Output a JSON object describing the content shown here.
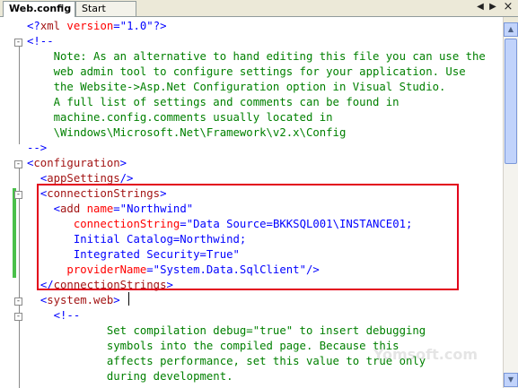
{
  "tabs": [
    {
      "label": "Web.config",
      "active": true
    },
    {
      "label": "Start Page",
      "active": false
    }
  ],
  "tab_controls": {
    "prev": "◀",
    "next": "▶",
    "close": "×"
  },
  "code_lines": [
    [
      {
        "c": "b",
        "t": "<?"
      },
      {
        "c": "m",
        "t": "xml"
      },
      {
        "c": "a",
        "t": " version"
      },
      {
        "c": "b",
        "t": "=\""
      },
      {
        "c": "b",
        "t": "1.0"
      },
      {
        "c": "b",
        "t": "\"?>"
      }
    ],
    [
      {
        "c": "b",
        "t": "<!--"
      }
    ],
    [
      {
        "c": "c",
        "t": "    Note: As an alternative to hand editing this file you can use the"
      }
    ],
    [
      {
        "c": "c",
        "t": "    web admin tool to configure settings for your application. Use"
      }
    ],
    [
      {
        "c": "c",
        "t": "    the Website->Asp.Net Configuration option in Visual Studio."
      }
    ],
    [
      {
        "c": "c",
        "t": "    A full list of settings and comments can be found in"
      }
    ],
    [
      {
        "c": "c",
        "t": "    machine.config.comments usually located in"
      }
    ],
    [
      {
        "c": "c",
        "t": "    \\Windows\\Microsoft.Net\\Framework\\v2.x\\Config"
      }
    ],
    [
      {
        "c": "b",
        "t": "-->"
      }
    ],
    [
      {
        "c": "b",
        "t": "<"
      },
      {
        "c": "m",
        "t": "configuration"
      },
      {
        "c": "b",
        "t": ">"
      }
    ],
    [
      {
        "c": "t",
        "t": "  "
      },
      {
        "c": "b",
        "t": "<"
      },
      {
        "c": "m",
        "t": "appSettings"
      },
      {
        "c": "b",
        "t": "/>"
      }
    ],
    [
      {
        "c": "t",
        "t": "  "
      },
      {
        "c": "b",
        "t": "<"
      },
      {
        "c": "m",
        "t": "connectionStrings"
      },
      {
        "c": "b",
        "t": ">"
      }
    ],
    [
      {
        "c": "t",
        "t": "    "
      },
      {
        "c": "b",
        "t": "<"
      },
      {
        "c": "m",
        "t": "add"
      },
      {
        "c": "a",
        "t": " name"
      },
      {
        "c": "b",
        "t": "=\""
      },
      {
        "c": "b",
        "t": "Northwind"
      },
      {
        "c": "b",
        "t": "\""
      }
    ],
    [
      {
        "c": "t",
        "t": "       "
      },
      {
        "c": "a",
        "t": "connectionString"
      },
      {
        "c": "b",
        "t": "=\""
      },
      {
        "c": "b",
        "t": "Data Source=BKKSQL001\\INSTANCE01;"
      }
    ],
    [
      {
        "c": "t",
        "t": "       "
      },
      {
        "c": "b",
        "t": "Initial Catalog=Northwind;"
      }
    ],
    [
      {
        "c": "t",
        "t": "       "
      },
      {
        "c": "b",
        "t": "Integrated Security=True"
      },
      {
        "c": "b",
        "t": "\""
      }
    ],
    [
      {
        "c": "t",
        "t": "      "
      },
      {
        "c": "a",
        "t": "providerName"
      },
      {
        "c": "b",
        "t": "=\""
      },
      {
        "c": "b",
        "t": "System.Data.SqlClient"
      },
      {
        "c": "b",
        "t": "\""
      },
      {
        "c": "b",
        "t": "/>"
      }
    ],
    [
      {
        "c": "t",
        "t": "  "
      },
      {
        "c": "b",
        "t": "</"
      },
      {
        "c": "m",
        "t": "connectionStrings"
      },
      {
        "c": "b",
        "t": ">"
      }
    ],
    [
      {
        "c": "t",
        "t": "  "
      },
      {
        "c": "b",
        "t": "<"
      },
      {
        "c": "m",
        "t": "system.web"
      },
      {
        "c": "b",
        "t": ">"
      }
    ],
    [
      {
        "c": "t",
        "t": "    "
      },
      {
        "c": "b",
        "t": "<!--"
      }
    ],
    [
      {
        "c": "c",
        "t": "            Set compilation debug=\"true\" to insert debugging"
      }
    ],
    [
      {
        "c": "c",
        "t": "            symbols into the compiled page. Because this"
      }
    ],
    [
      {
        "c": "c",
        "t": "            affects performance, set this value to true only"
      }
    ],
    [
      {
        "c": "c",
        "t": "            during development."
      }
    ]
  ],
  "fold_markers": [
    "-",
    "-",
    "-",
    "-",
    "-"
  ],
  "watermark": "Yomsoft.com"
}
